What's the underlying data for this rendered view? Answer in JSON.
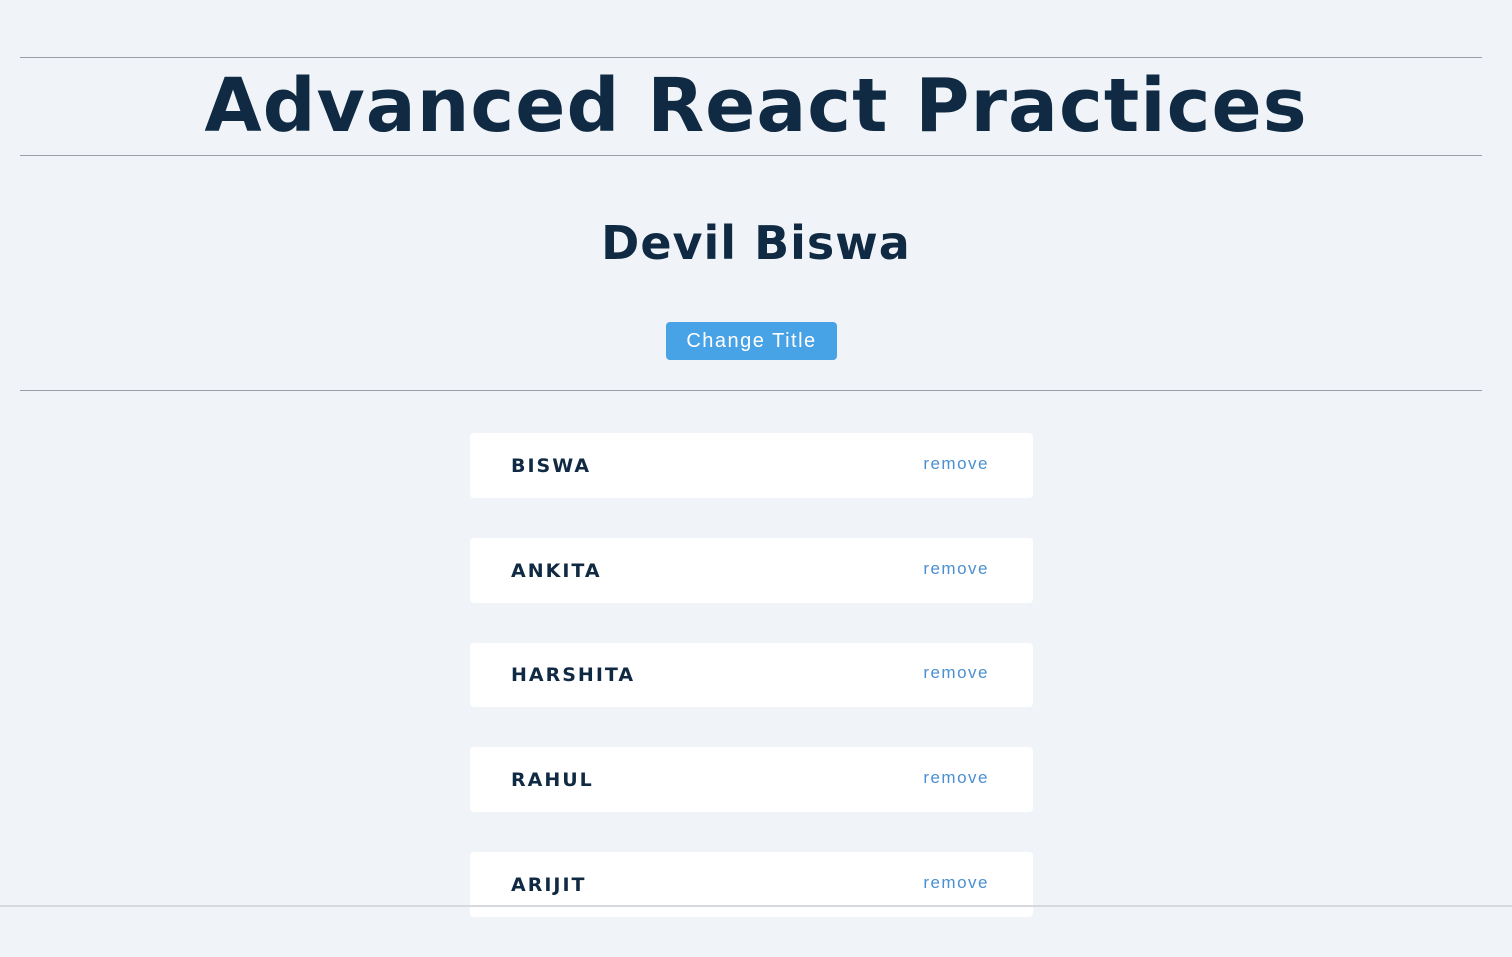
{
  "header": {
    "title": "Advanced React Practices"
  },
  "section": {
    "title": "Devil Biswa",
    "change_button_label": "Change Title"
  },
  "people": {
    "items": [
      {
        "name": "BISWA",
        "action": "remove"
      },
      {
        "name": "ANKITA",
        "action": "remove"
      },
      {
        "name": "HARSHITA",
        "action": "remove"
      },
      {
        "name": "RAHUL",
        "action": "remove"
      },
      {
        "name": "ARIJIT",
        "action": "remove"
      }
    ]
  },
  "colors": {
    "background": "#f0f4f8",
    "heading": "#102a43",
    "button": "#48a2e6",
    "link": "#4a8fd1",
    "card": "#ffffff"
  }
}
